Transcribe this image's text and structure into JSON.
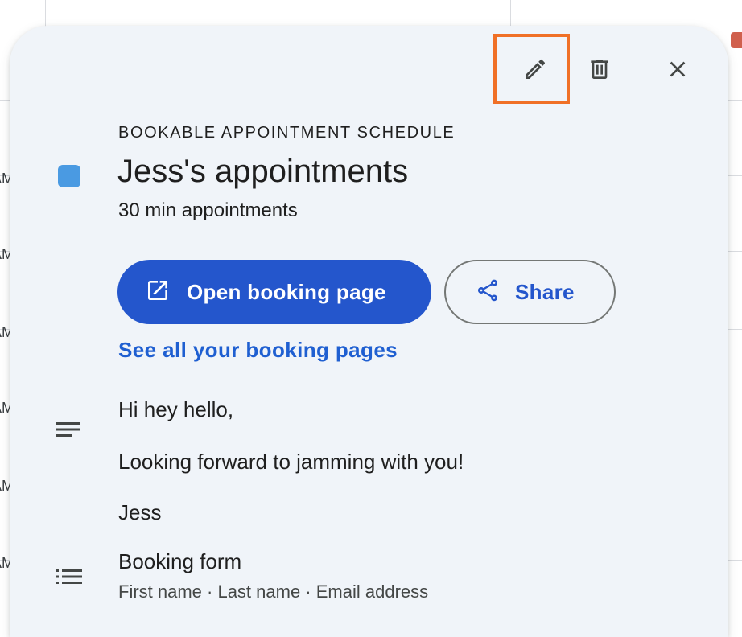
{
  "background": {
    "time_labels": [
      "AM",
      "AM",
      "AM",
      "AM",
      "AM",
      "AM"
    ]
  },
  "toolbar": {
    "edit_icon": "pencil-icon",
    "delete_icon": "trash-icon",
    "close_icon": "close-icon",
    "highlight_color": "#f07027"
  },
  "schedule": {
    "eyebrow": "BOOKABLE APPOINTMENT SCHEDULE",
    "title": "Jess's appointments",
    "subtitle": "30 min appointments",
    "color": "#4a9ae2"
  },
  "actions": {
    "open_booking_label": "Open booking page",
    "open_booking_icon": "open-in-new-icon",
    "share_label": "Share",
    "share_icon": "share-icon",
    "see_all_link": "See all your booking pages",
    "primary_color": "#2456cc",
    "link_color": "#1f5fd1"
  },
  "description": {
    "icon": "notes-icon",
    "lines": [
      "Hi hey hello,",
      "Looking forward to jamming with you!",
      "Jess"
    ]
  },
  "booking_form": {
    "icon": "list-icon",
    "title": "Booking form",
    "fields": "First name · Last name · Email address"
  }
}
